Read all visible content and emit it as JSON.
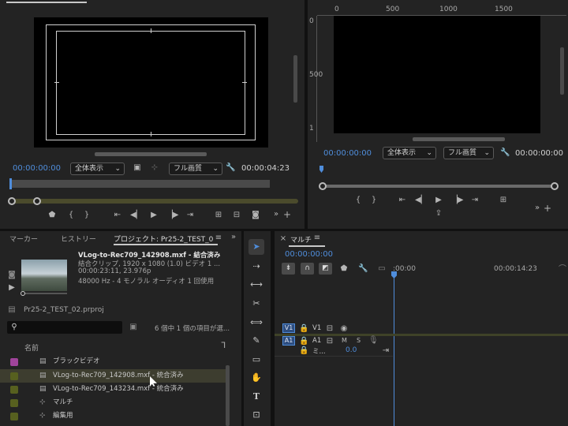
{
  "source": {
    "timecode": "00:00:00:00",
    "zoom": "全体表示",
    "quality": "フル画質",
    "duration": "00:00:04:23"
  },
  "program": {
    "timecode": "00:00:00:00",
    "zoom": "全体表示",
    "quality": "フル画質",
    "duration": "00:00:00:00",
    "ruler_ticks": [
      "0",
      "500",
      "1000",
      "1500"
    ],
    "vruler": [
      "0",
      "500",
      "1"
    ]
  },
  "project": {
    "tabs": [
      "マーカー",
      "ヒストリー",
      "プロジェクト: Pr25-2_TEST_0"
    ],
    "clip_name": "VLog-to-Rec709_142908.mxf - 結合済み",
    "clip_line2": "結合クリップ, 1920 x 1080 (1.0)  ビデオ 1 ...",
    "clip_line3": "00:00:23:11, 23.976p",
    "clip_line4": "48000 Hz - 4 モノラル  オーディオ 1 回使用",
    "project_file": "Pr25-2_TEST_02.prproj",
    "selection_status": "6 個中 1 個の項目が選...",
    "column_name": "名前",
    "items": [
      {
        "label": "ブラックビデオ",
        "color": "#a0449b",
        "selected": false
      },
      {
        "label": "VLog-to-Rec709_142908.mxf - 統合済み",
        "color": "#57601f",
        "selected": true
      },
      {
        "label": "VLog-to-Rec709_143234.mxf - 統合済み",
        "color": "#57601f",
        "selected": false
      },
      {
        "label": "マルチ",
        "color": "#57601f",
        "selected": false
      },
      {
        "label": "編集用",
        "color": "#57601f",
        "selected": false
      }
    ]
  },
  "timeline": {
    "title": "マルチ",
    "timecode": "00:00:00:00",
    "ruler_start": ":00:00",
    "ruler_mid": "00:00:14:23",
    "tracks": {
      "v1": "V1",
      "v1b": "V1",
      "a1": "A1",
      "a1b": "A1",
      "m": "M",
      "s": "S",
      "mix": "ミ...",
      "mix_val": "0.0"
    }
  },
  "colors": {
    "accent": "#4f8ddb",
    "timecode": "#3f82d8",
    "panel": "#232323"
  }
}
